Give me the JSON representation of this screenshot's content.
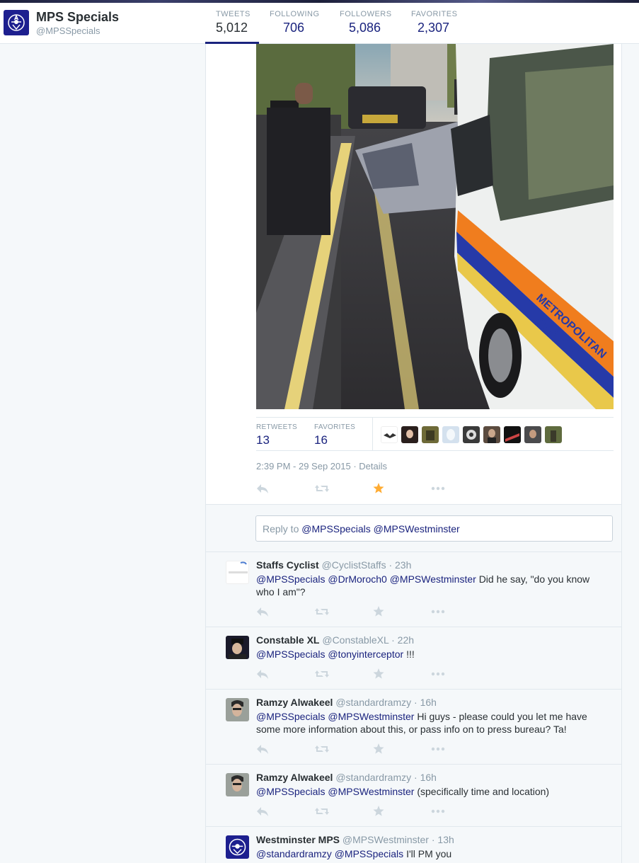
{
  "profile": {
    "name": "MPS Specials",
    "handle": "@MPSSpecials"
  },
  "stats": [
    {
      "label": "TWEETS",
      "value": "5,012"
    },
    {
      "label": "FOLLOWING",
      "value": "706"
    },
    {
      "label": "FOLLOWERS",
      "value": "5,086"
    },
    {
      "label": "FAVORITES",
      "value": "2,307"
    }
  ],
  "main_tweet": {
    "retweets_label": "RETWEETS",
    "retweets": "13",
    "favorites_label": "FAVORITES",
    "favorites": "16",
    "timestamp": "2:39 PM - 29 Sep 2015",
    "details": "· Details"
  },
  "reply": {
    "prefix": "Reply to",
    "mentions": "@MPSSpecials @MPSWestminster"
  },
  "replies": [
    {
      "name": "Staffs Cyclist",
      "handle": "@CyclistStaffs",
      "time": "· 23h",
      "mentions": "@MPSSpecials @DrMoroch0 @MPSWestminster",
      "text": "Did he say, \"do you know who I am\"?"
    },
    {
      "name": "Constable XL",
      "handle": "@ConstableXL",
      "time": "· 22h",
      "mentions": "@MPSSpecials @tonyinterceptor",
      "text": "!!!"
    },
    {
      "name": "Ramzy Alwakeel",
      "handle": "@standardramzy",
      "time": "· 16h",
      "mentions": "@MPSSpecials @MPSWestminster",
      "text": "Hi guys - please could you let me have some more information about this, or pass info on to press bureau? Ta!"
    },
    {
      "name": "Ramzy Alwakeel",
      "handle": "@standardramzy",
      "time": "· 16h",
      "mentions": "@MPSSpecials @MPSWestminster",
      "text": "(specifically time and location)"
    },
    {
      "name": "Westminster MPS",
      "handle": "@MPSWestminster",
      "time": "· 13h",
      "mentions": "@standardramzy @MPSSpecials",
      "text": "I'll PM you"
    }
  ],
  "icons": [
    "reply-icon",
    "retweet-icon",
    "favorite-icon",
    "more-icon",
    "met-police-crest-icon"
  ],
  "colors": {
    "brand": "#1a237e",
    "favorited": "#ffac33",
    "muted": "#8899a6"
  }
}
